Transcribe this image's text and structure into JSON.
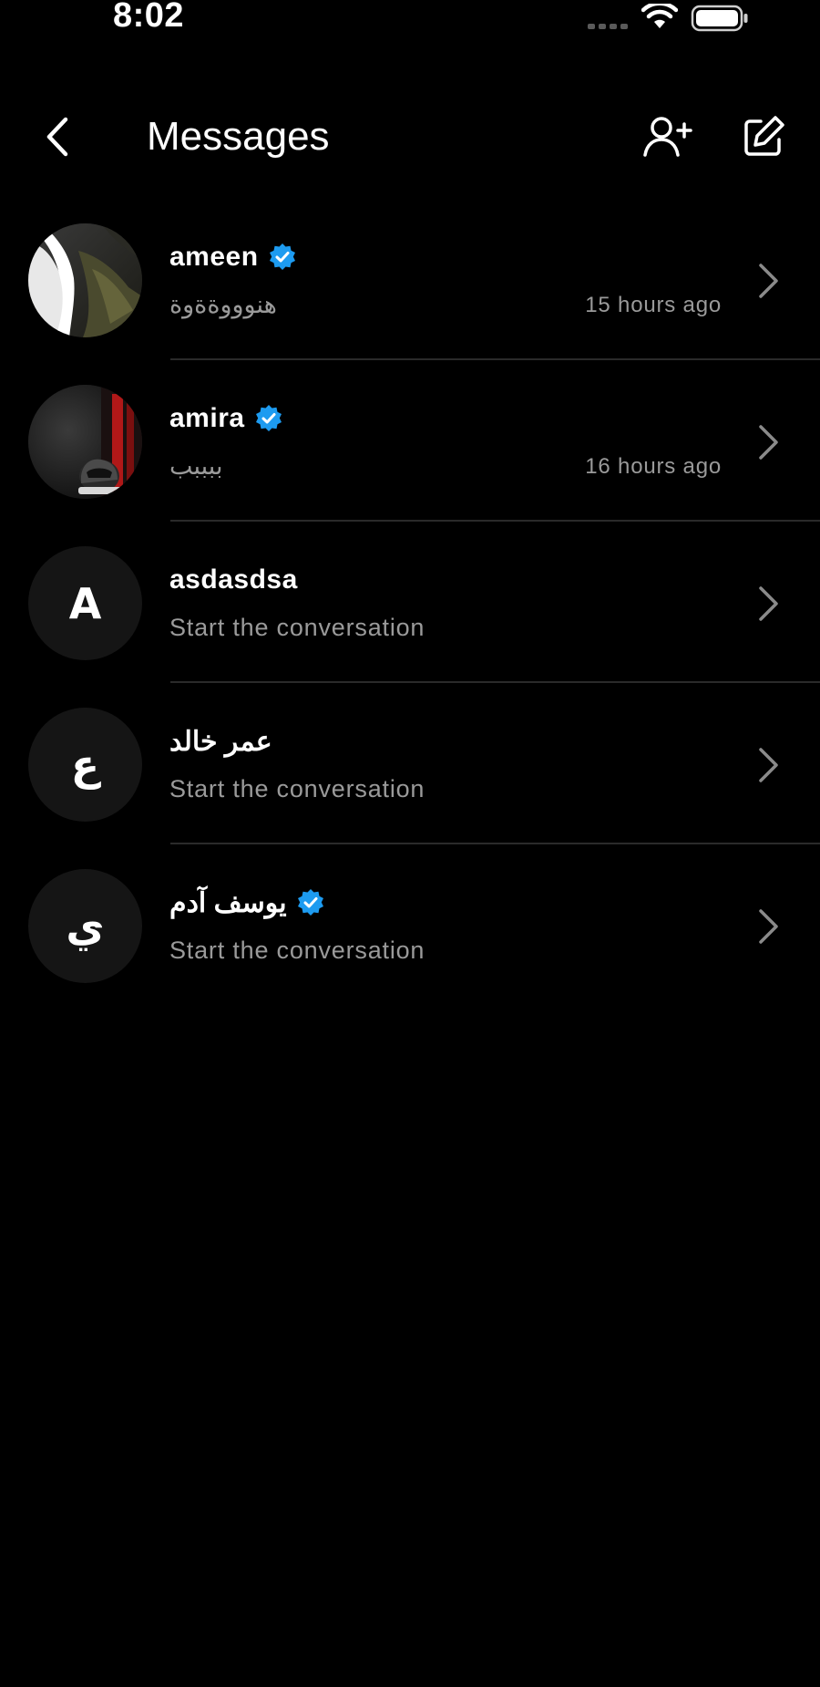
{
  "status_bar": {
    "time": "8:02"
  },
  "header": {
    "title": "Messages",
    "back_icon": "chevron-left-icon",
    "add_user_icon": "user-plus-icon",
    "compose_icon": "compose-icon"
  },
  "colors": {
    "background": "#000000",
    "verified": "#1d9bf0",
    "secondary_text": "#9a9a9a",
    "divider": "#2a2a2a",
    "avatar_placeholder": "#151515"
  },
  "conversations": [
    {
      "name": "ameen",
      "verified": true,
      "preview": "هنوووةةوة",
      "time": "15 hours ago",
      "avatar": "photo-waterfall"
    },
    {
      "name": "amira",
      "verified": true,
      "preview": "ببببب",
      "time": "16 hours ago",
      "avatar": "photo-helmet"
    },
    {
      "name": "asdasdsa",
      "verified": false,
      "preview": "Start the conversation",
      "time": "",
      "avatar_letter": "A"
    },
    {
      "name": "عمر خالد",
      "verified": false,
      "preview": "Start the conversation",
      "time": "",
      "avatar_letter": "ع"
    },
    {
      "name": "يوسف آدم",
      "verified": true,
      "preview": "Start the conversation",
      "time": "",
      "avatar_letter": "ي"
    }
  ]
}
